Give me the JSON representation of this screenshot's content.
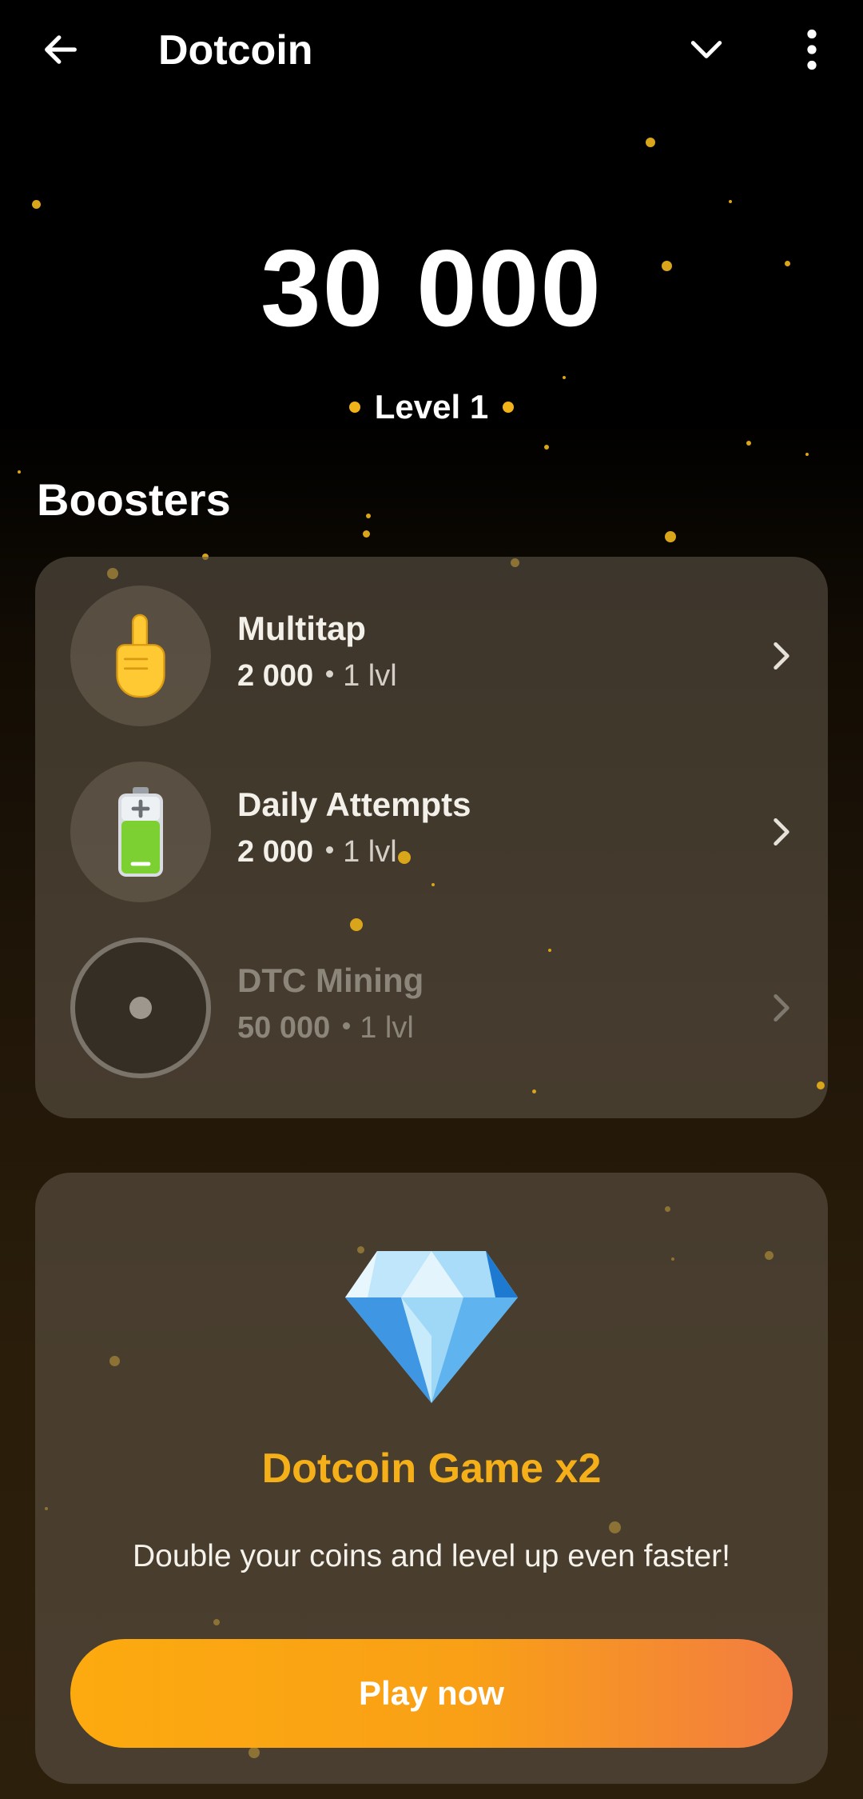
{
  "app": {
    "title": "Dotcoin",
    "icons": {
      "back": "arrow-left-icon",
      "collapse": "chevron-down-icon",
      "more": "more-vertical-icon"
    }
  },
  "balance": {
    "value": "30 000"
  },
  "level": {
    "label": "Level 1"
  },
  "boosters": {
    "title": "Boosters",
    "items": [
      {
        "name": "Multitap",
        "price": "2 000",
        "level": "1 lvl",
        "icon": "pointing-finger-icon",
        "enabled": true
      },
      {
        "name": "Daily Attempts",
        "price": "2 000",
        "level": "1 lvl",
        "icon": "battery-icon",
        "enabled": true
      },
      {
        "name": "DTC Mining",
        "price": "50 000",
        "level": "1 lvl",
        "icon": "mining-disc-icon",
        "enabled": false
      }
    ]
  },
  "promo": {
    "icon": "diamond-icon",
    "title": "Dotcoin Game x2",
    "description": "Double your coins and level up even faster!",
    "button_label": "Play now"
  },
  "colors": {
    "accent": "#f5b019",
    "button_start": "#fcaa0f",
    "button_end": "#f27c42",
    "card": "#5c5346"
  }
}
